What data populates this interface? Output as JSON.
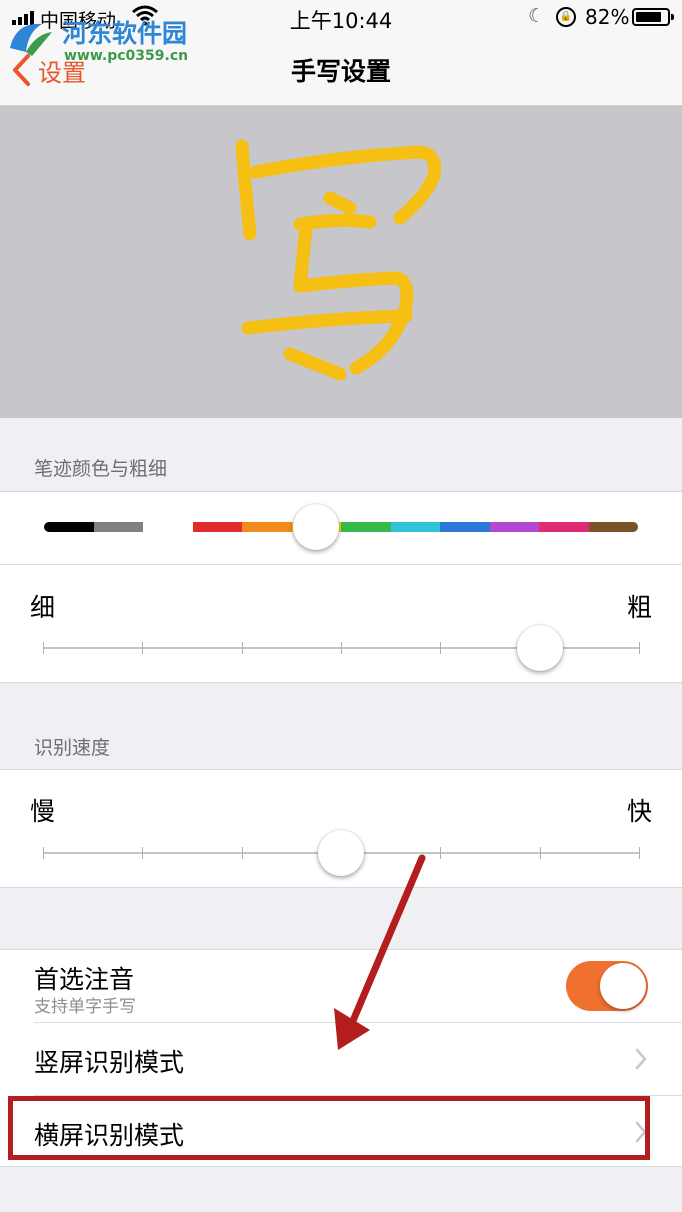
{
  "status_bar": {
    "carrier": "中国移动",
    "time": "上午10:44",
    "battery_percent": "82%",
    "battery_level": 0.82,
    "icons": [
      "signal-icon",
      "wifi-icon",
      "moon-icon",
      "orientation-lock-icon",
      "battery-icon"
    ]
  },
  "watermark": {
    "name": "河东软件园",
    "url": "www.pc0359.cn"
  },
  "nav": {
    "back_label": "设置",
    "title": "手写设置"
  },
  "preview": {
    "glyph": "写",
    "stroke_color": "#f5bf14"
  },
  "stroke_section": {
    "header": "笔迹颜色与粗细",
    "palette": [
      "#000000",
      "#808080",
      "#ffffff",
      "#e22b2b",
      "#f28a1e",
      "#f5d319",
      "#36b84a",
      "#2fc3d8",
      "#2a79d8",
      "#b249d0",
      "#e02b72",
      "#7a5228"
    ],
    "selected_color_index": 5,
    "thickness_min_label": "细",
    "thickness_max_label": "粗",
    "thickness_steps": 7,
    "thickness_value_step": 5
  },
  "speed_section": {
    "header": "识别速度",
    "slow_label": "慢",
    "fast_label": "快",
    "steps": 7,
    "value_step": 3
  },
  "options": {
    "zhuyin_label": "首选注音",
    "zhuyin_sub": "支持单字手写",
    "zhuyin_enabled": true,
    "portrait_mode_label": "竖屏识别模式",
    "landscape_mode_label": "横屏识别模式"
  },
  "annotation": {
    "color": "#b31d1d"
  }
}
